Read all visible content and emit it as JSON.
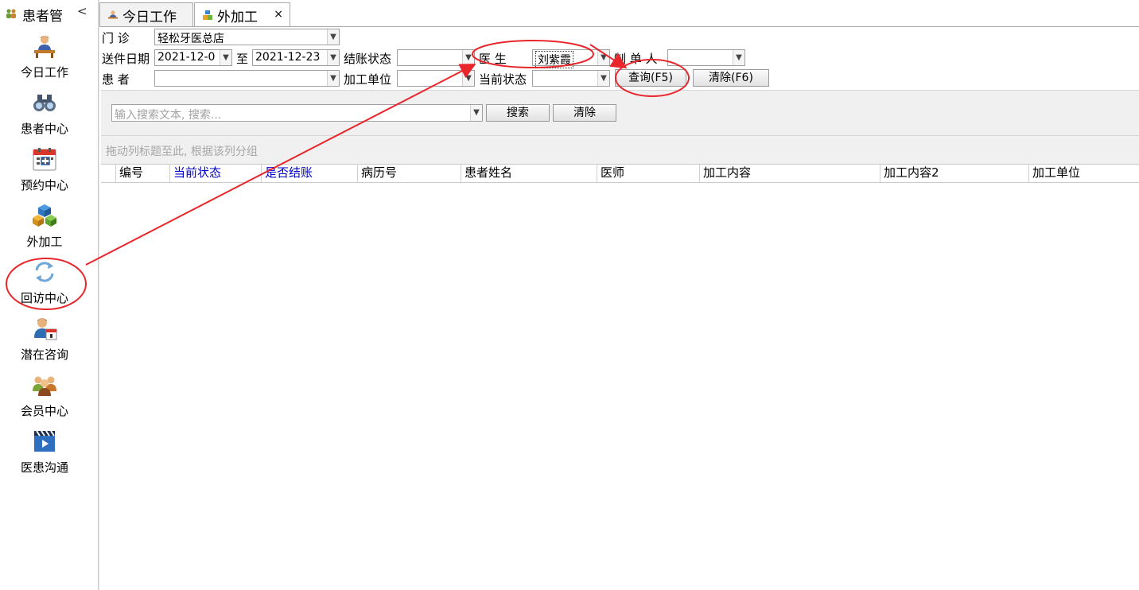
{
  "sidebar": {
    "title": "患者管",
    "collapse_glyph": "<",
    "items": [
      {
        "label": "今日工作",
        "icon": "worker-desk-icon"
      },
      {
        "label": "患者中心",
        "icon": "binoculars-icon"
      },
      {
        "label": "预约中心",
        "icon": "calendar-icon"
      },
      {
        "label": "外加工",
        "icon": "cubes-icon"
      },
      {
        "label": "回访中心",
        "icon": "refresh-cycle-icon"
      },
      {
        "label": "潜在咨询",
        "icon": "person-calendar-icon"
      },
      {
        "label": "会员中心",
        "icon": "group-members-icon"
      },
      {
        "label": "医患沟通",
        "icon": "video-clapper-icon"
      }
    ]
  },
  "tabs": [
    {
      "label": "今日工作",
      "icon": "worker-desk-icon",
      "active": false
    },
    {
      "label": "外加工",
      "icon": "cubes-icon",
      "active": true,
      "close": "×"
    }
  ],
  "filters": {
    "clinic_label": "门    诊",
    "clinic_value": "轻松牙医总店",
    "send_date_label": "送件日期",
    "date_from": "2021-12-0",
    "to_label": "至",
    "date_to": "2021-12-23",
    "settle_label": "结账状态",
    "settle_value": "",
    "doctor_label": "医     生",
    "doctor_value": "刘紫霞",
    "maker_label": "制 单 人",
    "maker_value": "",
    "patient_label": "患     者",
    "patient_value": "",
    "lab_label": "加工单位",
    "lab_value": "",
    "status_label": "当前状态",
    "status_value": "",
    "query_button": "查询(F5)",
    "clear_button": "清除(F6)"
  },
  "search": {
    "placeholder": "输入搜索文本, 搜索...",
    "search_button": "搜索",
    "clear_button": "清除"
  },
  "group_hint": "拖动列标题至此, 根据该列分组",
  "grid": {
    "columns": [
      {
        "label": "编号",
        "blue": false
      },
      {
        "label": "当前状态",
        "blue": true
      },
      {
        "label": "是否结账",
        "blue": true
      },
      {
        "label": "病历号",
        "blue": false
      },
      {
        "label": "患者姓名",
        "blue": false
      },
      {
        "label": "医师",
        "blue": false
      },
      {
        "label": "加工内容",
        "blue": false
      },
      {
        "label": "加工内容2",
        "blue": false
      },
      {
        "label": "加工单位",
        "blue": false
      }
    ],
    "rows": []
  },
  "annotation_color": "#e8262b"
}
